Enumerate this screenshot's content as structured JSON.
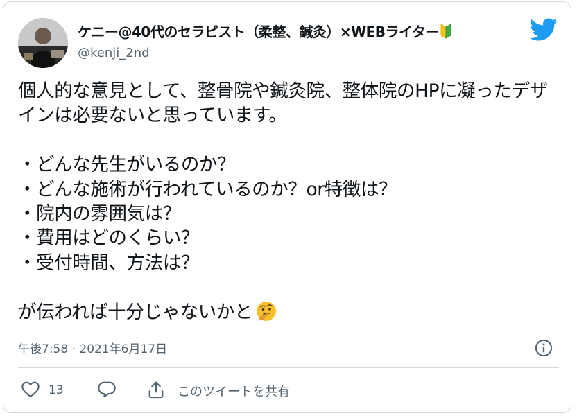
{
  "tweet": {
    "author_name": "ケニー@40代のセラピスト（柔整、鍼灸）×WEBライター",
    "author_handle": "@kenji_2nd",
    "text": "個人的な意見として、整骨院や鍼灸院、整体院のHPに凝ったデザインは必要ないと思っています。\n\n・どんな先生がいるのか？\n・どんな施術が行われているのか？or特徴は？\n・院内の雰囲気は？\n・費用はどのくらい？\n・受付時間、方法は？\n\nが伝われば十分じゃないかと",
    "timestamp": "午後7:58 · 2021年6月17日",
    "like_count": "13",
    "share_label": "このツイートを共有"
  },
  "icons": [
    "beginner-mark-icon",
    "twitter-bird-icon",
    "thinking-face-emoji",
    "info-icon",
    "heart-icon",
    "reply-icon",
    "share-icon"
  ],
  "colors": {
    "twitter_blue": "#1d9bf0",
    "muted_text": "#536471",
    "border": "#cfd9de"
  }
}
